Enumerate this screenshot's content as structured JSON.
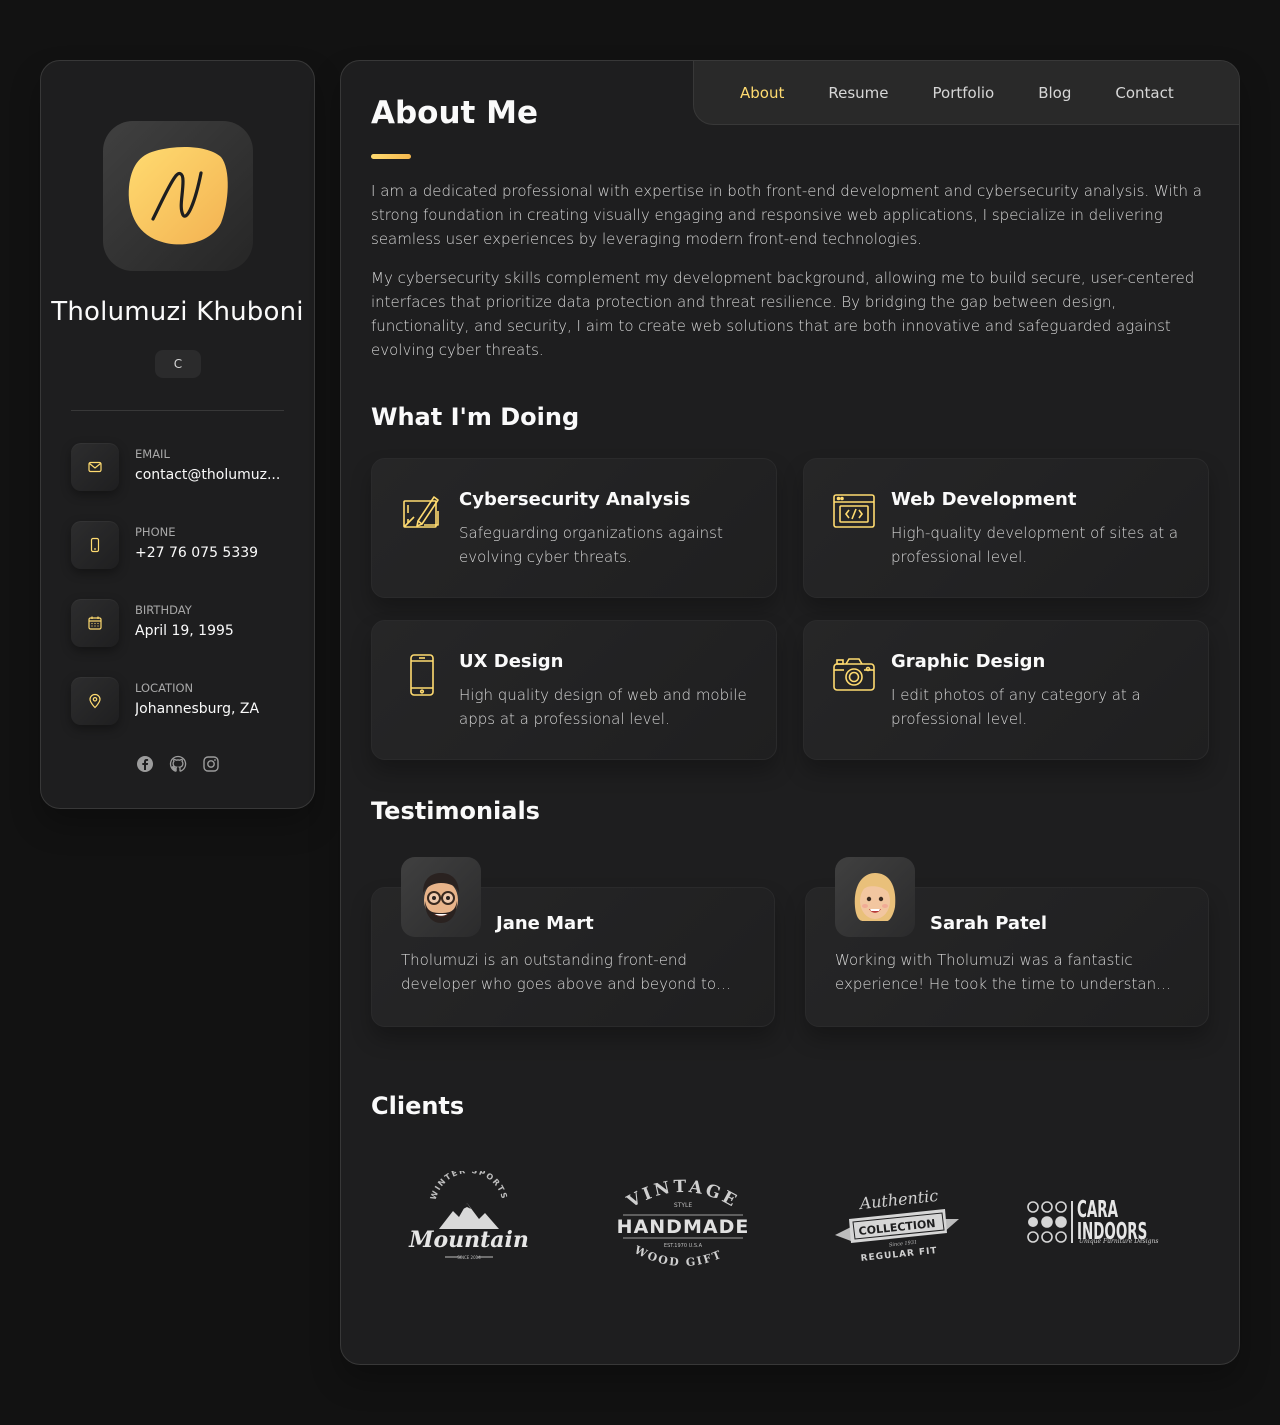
{
  "profile": {
    "name": "Tholumuzi Khuboni",
    "title": "C",
    "avatar_icon": "signature-logo-icon"
  },
  "contacts": [
    {
      "label": "Email",
      "value": "contact@tholumuzi.com",
      "display": "contact@tholumuz...",
      "icon": "mail-icon"
    },
    {
      "label": "Phone",
      "value": "+27 76 075 5339",
      "icon": "phone-icon"
    },
    {
      "label": "Birthday",
      "value": "April 19, 1995",
      "icon": "calendar-icon"
    },
    {
      "label": "Location",
      "value": "Johannesburg, ZA",
      "icon": "location-pin-icon"
    }
  ],
  "socials": [
    "facebook-icon",
    "github-icon",
    "instagram-icon"
  ],
  "nav": [
    {
      "label": "About",
      "active": true
    },
    {
      "label": "Resume",
      "active": false
    },
    {
      "label": "Portfolio",
      "active": false
    },
    {
      "label": "Blog",
      "active": false
    },
    {
      "label": "Contact",
      "active": false
    }
  ],
  "about": {
    "title": "About Me",
    "paragraphs": [
      "I am a dedicated professional with expertise in both front-end development and cybersecurity analysis. With a strong foundation in creating visually engaging and responsive web applications, I specialize in delivering seamless user experiences by leveraging modern front-end technologies.",
      "My cybersecurity skills complement my development background, allowing me to build secure, user-centered interfaces that prioritize data protection and threat resilience. By bridging the gap between design, functionality, and security, I aim to create web solutions that are both innovative and safeguarded against evolving cyber threats."
    ]
  },
  "services": {
    "title": "What I'm Doing",
    "items": [
      {
        "title": "Cybersecurity Analysis",
        "text": "Safeguarding organizations against evolving cyber threats.",
        "icon": "design-tools-icon"
      },
      {
        "title": "Web Development",
        "text": "High-quality development of sites at a professional level.",
        "icon": "code-window-icon"
      },
      {
        "title": "UX Design",
        "text": "High quality design of web and mobile apps at a professional level.",
        "icon": "mobile-phone-icon"
      },
      {
        "title": "Graphic Design",
        "text": "I edit photos of any category at a professional level.",
        "icon": "camera-icon"
      }
    ]
  },
  "testimonials": {
    "title": "Testimonials",
    "items": [
      {
        "name": "Jane Mart",
        "text": "Tholumuzi is an outstanding front-end developer who goes above and beyond to deliver quality work.",
        "avatar": "memoji-man-icon"
      },
      {
        "name": "Sarah Patel",
        "text": "Working with Tholumuzi was a fantastic experience! He took the time to understand our needs.",
        "avatar": "memoji-woman-icon"
      }
    ]
  },
  "clients": {
    "title": "Clients",
    "logos": [
      {
        "name": "Mountain",
        "top": "WINTER SPORTS",
        "bottom": "SINCE 2014"
      },
      {
        "name": "HANDMADE",
        "top": "VINTAGE",
        "sub": "STYLE",
        "tag": "EST.1970 U.S.A",
        "bottom": "WOOD GIFTS"
      },
      {
        "name": "COLLECTION",
        "top": "Authentic",
        "sub": "Since 1931",
        "bottom": "REGULAR FIT"
      },
      {
        "name": "CARA INDOORS",
        "sub": "Unique Furniture Designs"
      }
    ]
  },
  "colors": {
    "accent": "#ffdb70",
    "background": "#121212",
    "card": "#1e1e1f",
    "border": "#383838"
  }
}
